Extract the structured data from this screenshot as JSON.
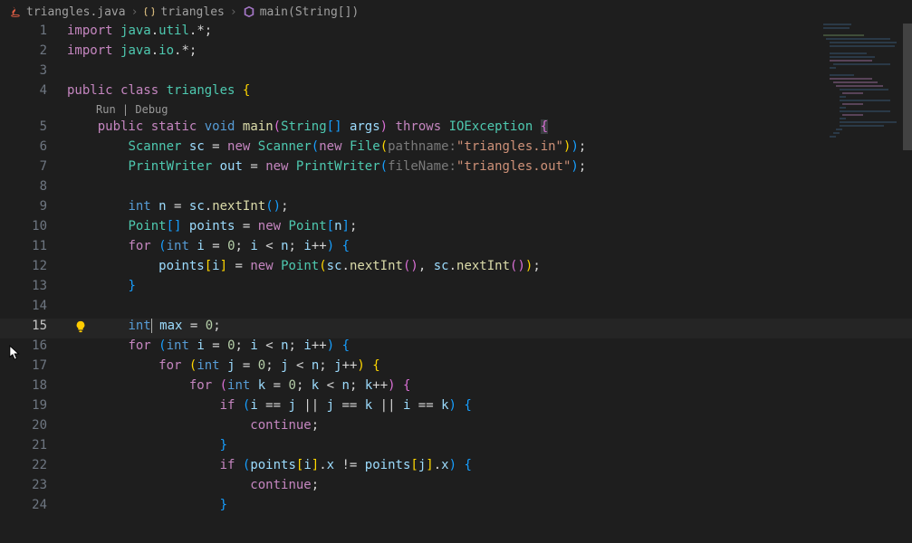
{
  "breadcrumb": {
    "file": "triangles.java",
    "class": "triangles",
    "method": "main(String[])"
  },
  "codelens": {
    "run": "Run",
    "sep": " | ",
    "debug": "Debug"
  },
  "lines": {
    "l1": "import java.util.*;",
    "l2": "import java.io.*;",
    "l3": "",
    "l4": "public class triangles {",
    "l5": "    public static void main(String[] args) throws IOException {",
    "l6": "        Scanner sc = new Scanner(new File(pathname:\"triangles.in\"));",
    "l7": "        PrintWriter out = new PrintWriter(fileName:\"triangles.out\");",
    "l8": "",
    "l9": "        int n = sc.nextInt();",
    "l10": "        Point[] points = new Point[n];",
    "l11": "        for (int i = 0; i < n; i++) {",
    "l12": "            points[i] = new Point(sc.nextInt(), sc.nextInt());",
    "l13": "        }",
    "l14": "",
    "l15": "        int max = 0;",
    "l16": "        for (int i = 0; i < n; i++) {",
    "l17": "            for (int j = 0; j < n; j++) {",
    "l18": "                for (int k = 0; k < n; k++) {",
    "l19": "                    if (i == j || j == k || i == k) {",
    "l20": "                        continue;",
    "l21": "                    }",
    "l22": "                    if (points[i].x != points[j].x) {",
    "l23": "                        continue;",
    "l24": "                    }"
  },
  "lineNumbers": [
    "1",
    "2",
    "3",
    "4",
    "5",
    "6",
    "7",
    "8",
    "9",
    "10",
    "11",
    "12",
    "13",
    "14",
    "15",
    "16",
    "17",
    "18",
    "19",
    "20",
    "21",
    "22",
    "23",
    "24"
  ],
  "activeLine": "15"
}
